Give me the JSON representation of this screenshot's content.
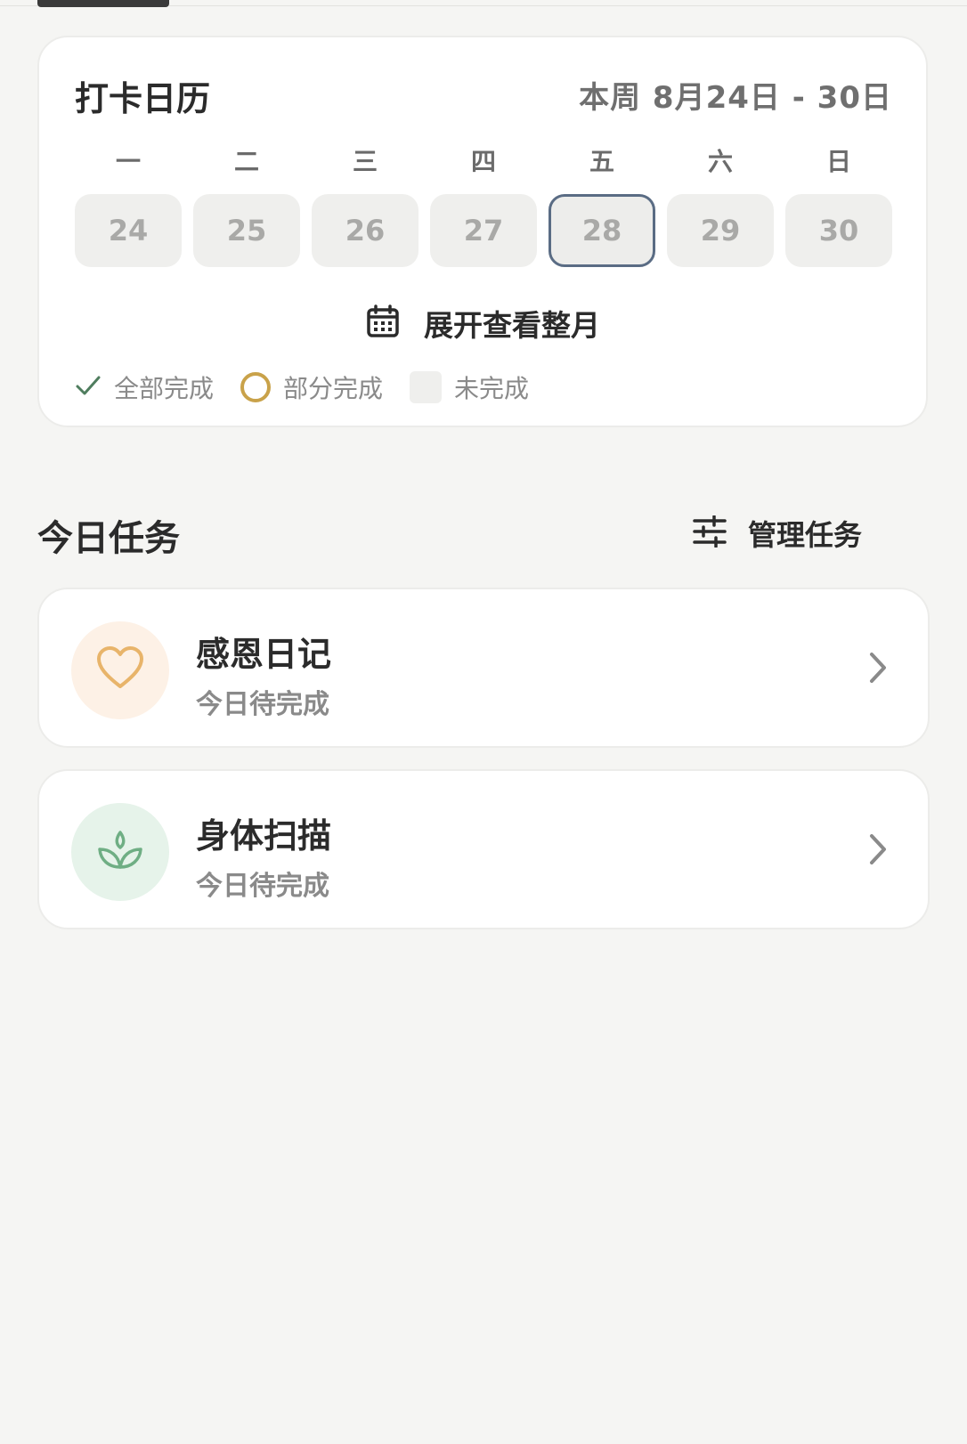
{
  "calendar": {
    "title": "打卡日历",
    "range": "本周 8月24日 - 30日",
    "weekdays": [
      "一",
      "二",
      "三",
      "四",
      "五",
      "六",
      "日"
    ],
    "days": [
      "24",
      "25",
      "26",
      "27",
      "28",
      "29",
      "30"
    ],
    "selected_day": "28",
    "expand_label": "展开查看整月",
    "legend": {
      "complete": "全部完成",
      "partial": "部分完成",
      "incomplete": "未完成"
    }
  },
  "tasks_section": {
    "title": "今日任务",
    "manage_label": "管理任务"
  },
  "tasks": [
    {
      "name": "感恩日记",
      "status": "今日待完成",
      "icon": "heart-icon",
      "icon_bg": "#fdf1e6",
      "icon_color": "#e8b46a"
    },
    {
      "name": "身体扫描",
      "status": "今日待完成",
      "icon": "sprout-icon",
      "icon_bg": "#e6f3ea",
      "icon_color": "#6fae84"
    }
  ],
  "colors": {
    "selected_border": "#5a6c84",
    "check": "#4f7d5e",
    "partial_ring": "#c9a24a"
  }
}
